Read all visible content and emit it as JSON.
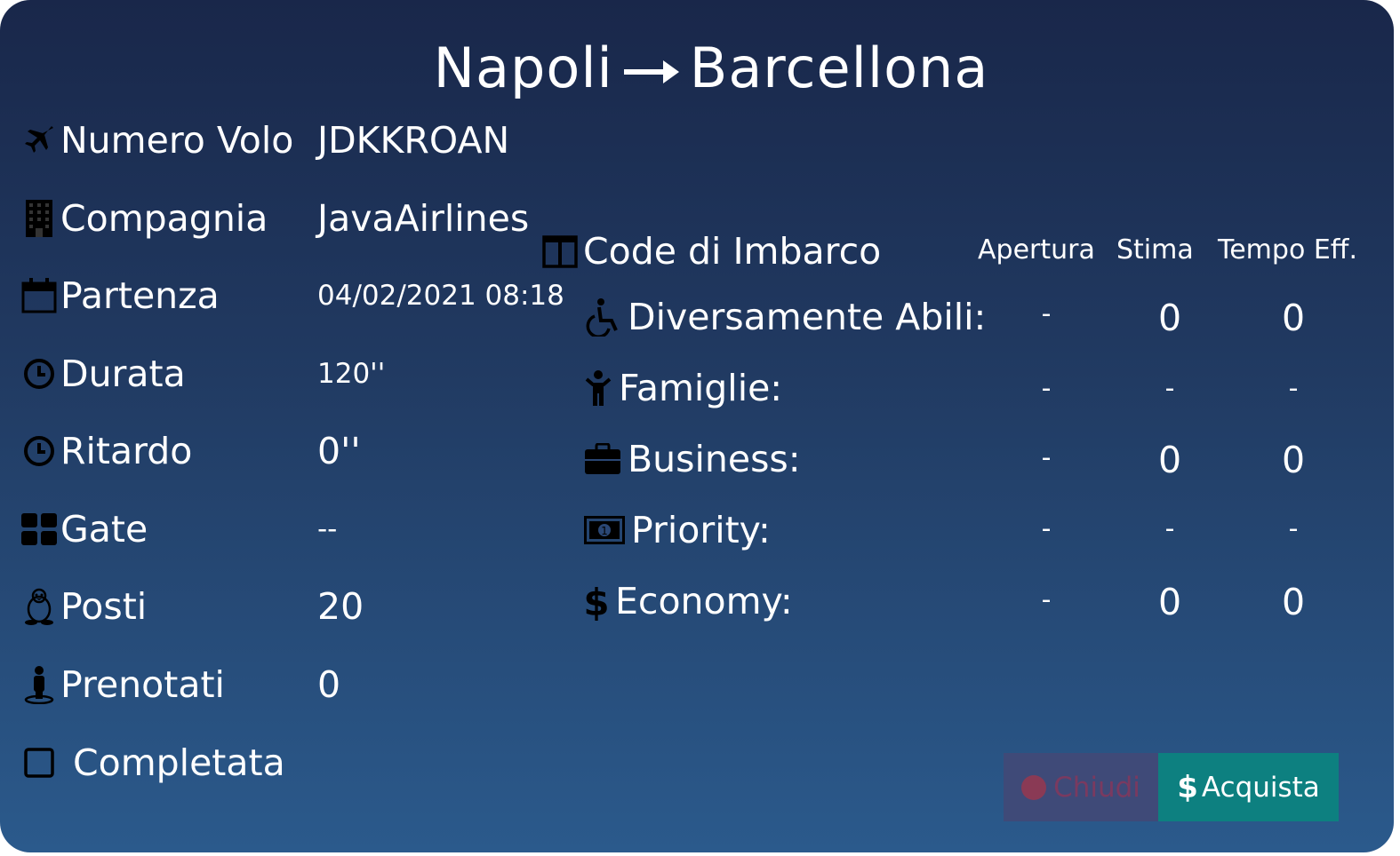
{
  "title": {
    "from": "Napoli",
    "to": "Barcellona"
  },
  "details": [
    {
      "icon": "plane-icon",
      "label": "Numero Volo",
      "value": "JDKKROAN"
    },
    {
      "icon": "building-icon",
      "label": "Compagnia",
      "value": "JavaAirlines"
    },
    {
      "icon": "calendar-icon",
      "label": "Partenza",
      "value": "04/02/2021 08:18"
    },
    {
      "icon": "clock-icon",
      "label": "Durata",
      "value": "120''"
    },
    {
      "icon": "clock-icon",
      "label": "Ritardo",
      "value": "0''"
    },
    {
      "icon": "grid-icon",
      "label": "Gate",
      "value": "--"
    },
    {
      "icon": "linux-penguin-icon",
      "label": "Posti",
      "value": "20"
    },
    {
      "icon": "person-icon",
      "label": "Prenotati",
      "value": "0"
    },
    {
      "icon": "checkbox-icon",
      "label": "Completata",
      "value": ""
    }
  ],
  "queues": {
    "heading": "Code di Imbarco",
    "columns": [
      "Apertura",
      "Stima",
      "Tempo Eff."
    ],
    "rows": [
      {
        "icon": "wheelchair-icon",
        "label": "Diversamente Abili:",
        "apertura": "-",
        "stima": "0",
        "tempo": "0"
      },
      {
        "icon": "child-icon",
        "label": "Famiglie:",
        "apertura": "-",
        "stima": "-",
        "tempo": "-"
      },
      {
        "icon": "briefcase-icon",
        "label": "Business:",
        "apertura": "-",
        "stima": "0",
        "tempo": "0"
      },
      {
        "icon": "money-icon",
        "label": "Priority:",
        "apertura": "-",
        "stima": "-",
        "tempo": "-"
      },
      {
        "icon": "dollar-icon",
        "label": "Economy:",
        "apertura": "-",
        "stima": "0",
        "tempo": "0"
      }
    ]
  },
  "buttons": {
    "close": "Chiudi",
    "buy": "Acquista",
    "buy_icon": "$"
  },
  "colors": {
    "buy_bg": "#0d8080",
    "close_bg": "#3f4a78",
    "close_fg": "#7a3a60"
  }
}
